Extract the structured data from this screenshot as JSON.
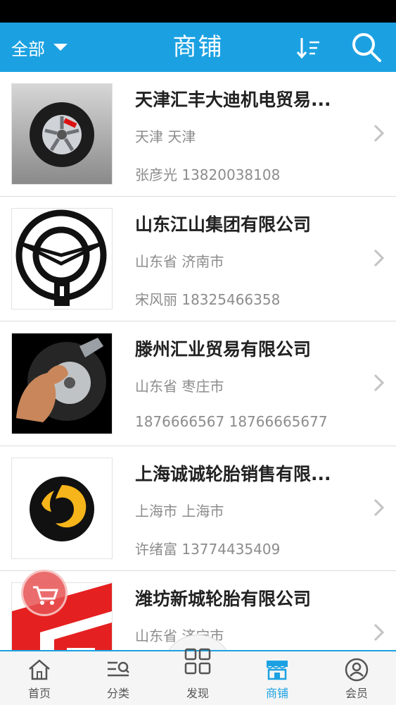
{
  "header": {
    "filter_label": "全部",
    "title": "商铺",
    "sort_icon": "sort-icon",
    "search_icon": "search-icon",
    "bg_color": "#1ba1e2"
  },
  "shops": [
    {
      "name": "天津汇丰大迪机电贸易...",
      "location": "天津 天津",
      "contact": "张彦光  13820038108",
      "image": "tire-wheel-logo"
    },
    {
      "name": "山东江山集团有限公司",
      "location": "山东省 济南市",
      "contact": "宋风丽 18325466358",
      "image": "emblem-logo"
    },
    {
      "name": "滕州汇业贸易有限公司",
      "location": "山东省 枣庄市",
      "contact": "1876666567 18766665677",
      "image": "muscle-arm-logo"
    },
    {
      "name": "上海诚诚轮胎销售有限...",
      "location": "上海市 上海市",
      "contact": "许绪富 13774435409",
      "image": "spiral-logo"
    },
    {
      "name": "潍坊新城轮胎有限公司",
      "location": "山东省 济宁市",
      "contact": "",
      "image": "red-g-logo"
    }
  ],
  "tabbar": {
    "tabs": [
      {
        "label": "首页",
        "icon": "home-icon"
      },
      {
        "label": "分类",
        "icon": "category-icon"
      },
      {
        "label": "发现",
        "icon": "discover-icon"
      },
      {
        "label": "商铺",
        "icon": "shop-icon",
        "active": true
      },
      {
        "label": "会员",
        "icon": "member-icon"
      }
    ]
  }
}
